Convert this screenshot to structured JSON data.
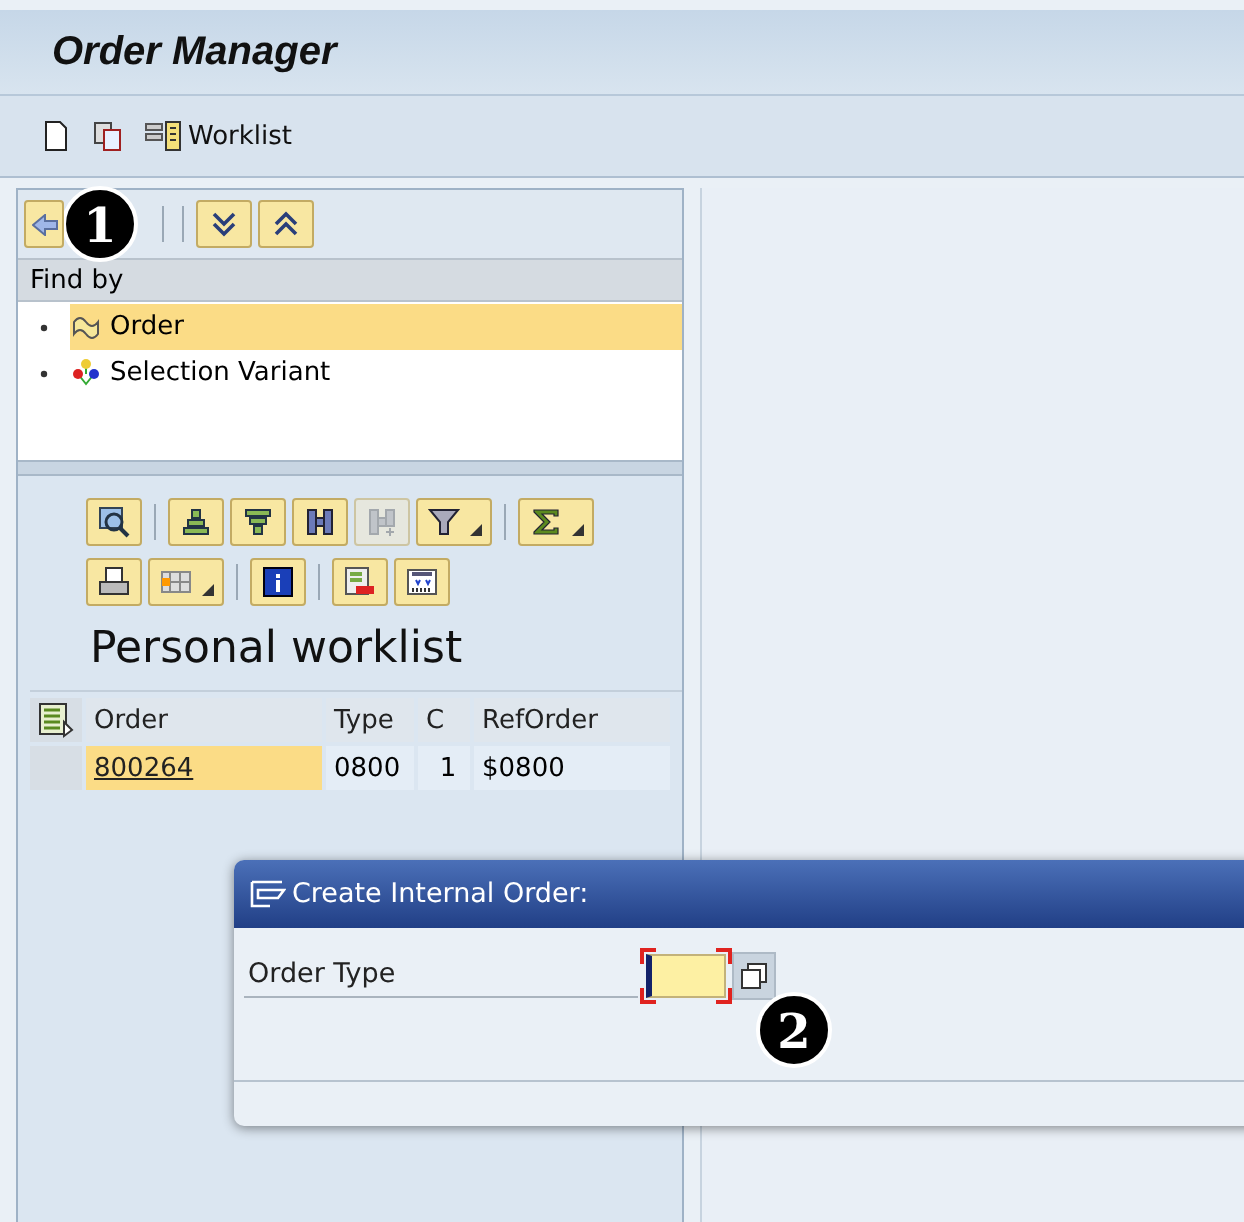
{
  "title": "Order Manager",
  "toolbar": [
    {
      "kind": "new"
    },
    {
      "kind": "copy"
    },
    {
      "kind": "worklist",
      "label": "Worklist"
    }
  ],
  "navigator": {
    "callout": "1",
    "buttons": [
      {
        "kind": "back"
      },
      {
        "kind": "callout"
      },
      {
        "kind": "separator"
      },
      {
        "kind": "expand"
      },
      {
        "kind": "collapse"
      }
    ],
    "header": "Find by",
    "items": [
      {
        "kind": "order",
        "label": "Order",
        "selected": true
      },
      {
        "kind": "variant",
        "label": "Selection Variant",
        "selected": false
      }
    ]
  },
  "worklist": {
    "tools": [
      [
        {
          "kind": "zoom",
          "disabled": false,
          "dropdown": false
        },
        {
          "kind": "separator"
        },
        {
          "kind": "sort-up",
          "disabled": false,
          "dropdown": false
        },
        {
          "kind": "sort-down",
          "disabled": false,
          "dropdown": false
        },
        {
          "kind": "find",
          "disabled": false,
          "dropdown": false
        },
        {
          "kind": "find-next",
          "disabled": true,
          "dropdown": false
        },
        {
          "kind": "filter",
          "disabled": false,
          "dropdown": true
        },
        {
          "kind": "separator"
        },
        {
          "kind": "sum",
          "disabled": false,
          "dropdown": true
        }
      ],
      [
        {
          "kind": "print",
          "disabled": false,
          "dropdown": false
        },
        {
          "kind": "layout",
          "disabled": false,
          "dropdown": true
        },
        {
          "kind": "separator"
        },
        {
          "kind": "info",
          "disabled": false,
          "dropdown": false
        },
        {
          "kind": "separator"
        },
        {
          "kind": "export",
          "disabled": false,
          "dropdown": false
        },
        {
          "kind": "columns",
          "disabled": false,
          "dropdown": false
        }
      ]
    ],
    "title": "Personal worklist",
    "columns": [
      "Order",
      "Type",
      "C",
      "RefOrder"
    ],
    "rows": [
      {
        "cells": [
          "800264",
          "0800",
          "1",
          "$0800"
        ]
      }
    ]
  },
  "dialog": {
    "title": "Create Internal Order:",
    "callout": "2",
    "fields": [
      {
        "label": "Order Type",
        "focused": true
      }
    ]
  }
}
